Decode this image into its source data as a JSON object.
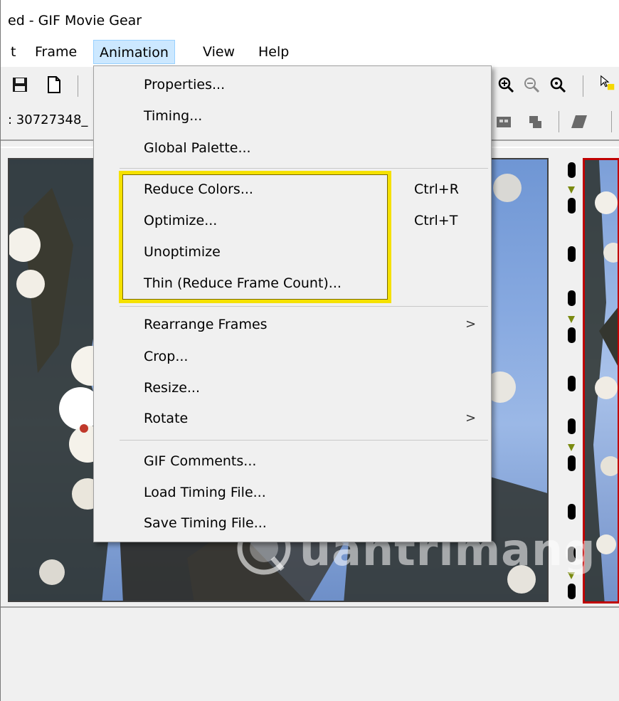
{
  "window": {
    "title": "ed - GIF Movie Gear"
  },
  "menubar": {
    "items": [
      {
        "label": "t"
      },
      {
        "label": "Frame"
      },
      {
        "label": "Animation"
      },
      {
        "label": "View"
      },
      {
        "label": "Help"
      }
    ]
  },
  "toolbar": {
    "field_text": ": 30727348_",
    "icons": [
      "save-icon",
      "new-document-icon",
      "zoom-in-icon",
      "zoom-out-icon",
      "zoom-reset-icon",
      "pointer-icon"
    ]
  },
  "animation_menu": {
    "items": [
      {
        "label": "Properties...",
        "shortcut": "",
        "submenu": false
      },
      {
        "label": "Timing...",
        "shortcut": "",
        "submenu": false
      },
      {
        "label": "Global Palette...",
        "shortcut": "",
        "submenu": false
      },
      {
        "label": "Reduce Colors...",
        "shortcut": "Ctrl+R",
        "submenu": false
      },
      {
        "label": "Optimize...",
        "shortcut": "Ctrl+T",
        "submenu": false
      },
      {
        "label": "Unoptimize",
        "shortcut": "",
        "submenu": false
      },
      {
        "label": "Thin (Reduce Frame Count)...",
        "shortcut": "",
        "submenu": false
      },
      {
        "label": "Rearrange Frames",
        "shortcut": "",
        "submenu": true
      },
      {
        "label": "Crop...",
        "shortcut": "",
        "submenu": false
      },
      {
        "label": "Resize...",
        "shortcut": "",
        "submenu": false
      },
      {
        "label": "Rotate",
        "shortcut": "",
        "submenu": true
      },
      {
        "label": "GIF Comments...",
        "shortcut": "",
        "submenu": false
      },
      {
        "label": "Load Timing File...",
        "shortcut": "",
        "submenu": false
      },
      {
        "label": "Save Timing File...",
        "shortcut": "",
        "submenu": false
      }
    ],
    "submenu_glyph": ">"
  },
  "watermark": {
    "text": "uantrimang"
  },
  "colors": {
    "highlight": "#f5e100",
    "menu_active": "#cce8ff",
    "thumbnail_border": "#c00000"
  }
}
